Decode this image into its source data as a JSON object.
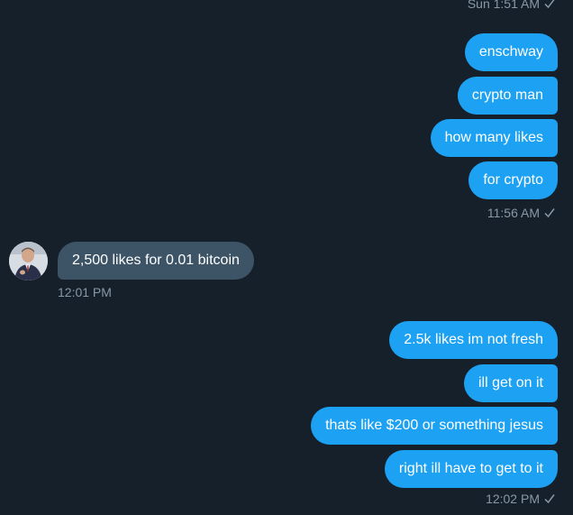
{
  "timestamps": {
    "top": "Sun 1:51 AM",
    "group1": "11:56 AM",
    "incoming": "12:01 PM",
    "group2": "12:02 PM"
  },
  "messages_group1": [
    "enschway",
    "crypto man",
    "how many likes",
    "for crypto"
  ],
  "incoming_message": "2,500 likes for 0.01 bitcoin",
  "messages_group2": [
    "2.5k likes im not fresh",
    "ill get on it",
    "thats like $200 or something jesus",
    "right ill have to get to it"
  ],
  "colors": {
    "background": "#16202b",
    "outgoing_bubble": "#1da1f2",
    "incoming_bubble": "#3d5466",
    "meta_text": "#8899a6"
  },
  "icons": {
    "read_receipt": "checkmark-icon",
    "avatar": "user-avatar"
  }
}
